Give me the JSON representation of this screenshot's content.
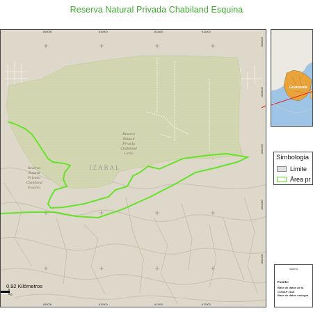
{
  "title": "Reserva Natural Privada Chabiland Esquina",
  "map": {
    "grid_x_labels": [
      "609000",
      "610000",
      "611000",
      "612000"
    ],
    "grid_y_labels": [
      "1606000",
      "1605000",
      "1604000",
      "1603000",
      "1602000"
    ],
    "department_label": "IZABAL",
    "reserve_esquina_label": [
      "Reserva",
      "Natural",
      "Privada",
      "Chabiland",
      "Esquina"
    ],
    "reserve_cerro_label": [
      "Reserva",
      "Natural",
      "Privada",
      "Chabiland",
      "Cerro"
    ],
    "scale_label": "0.92 Kilómetros",
    "colors": {
      "terrain": "#ddd8c9",
      "protected_fill": "#d4d8b2",
      "study_boundary": "#66e22b",
      "title": "#3daa2e"
    }
  },
  "inset": {
    "label": "Guatemala",
    "colors": {
      "sea": "#9ec4e6",
      "land": "#ece9e2",
      "country": "#e8a33a"
    }
  },
  "legend": {
    "title": "Simbologia",
    "items": [
      {
        "label": "Limite",
        "swatch": "#e0e0e0",
        "border": "#888888"
      },
      {
        "label": "Área pr",
        "swatch": "#ffffff",
        "border": "#66e22b"
      }
    ]
  },
  "info": {
    "top_label": "Sistem",
    "fuente_label": "Fuente:",
    "lines": [
      "Base de datos de la",
      "CONAP 2016",
      "Base de datos cartogra"
    ]
  }
}
